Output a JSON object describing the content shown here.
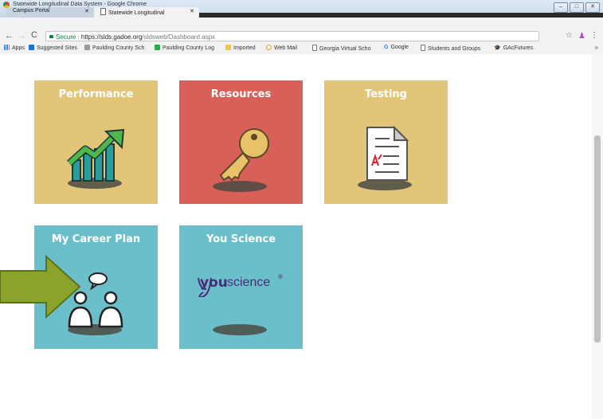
{
  "browser": {
    "app_title": "Statewide Longitudinal Data System - Google Chrome",
    "tabs": [
      {
        "label": "Campus Portal",
        "active": false
      },
      {
        "label": "Statewide Longitudinal ",
        "active": true
      }
    ],
    "secure_label": "Secure",
    "url_host": "https://slds.gadoe.org",
    "url_path": "/sldsweb/Dashboard.aspx",
    "bookmarks": [
      "Apps",
      "Suggested Sites",
      "Paulding County Sch",
      "Paulding County Log",
      "Imported",
      "Web Mail",
      "Georgia Virtual Scho",
      "Google",
      "Students and Groups",
      "GAcFutures"
    ],
    "more_bookmarks": "»"
  },
  "tiles": [
    {
      "title": "Performance",
      "color": "#e3c57a",
      "icon": "growth-chart-icon"
    },
    {
      "title": "Resources",
      "color": "#d95f59",
      "icon": "key-icon"
    },
    {
      "title": "Testing",
      "color": "#e3c57a",
      "icon": "document-icon"
    },
    {
      "title": "My Career Plan",
      "color": "#6abfca",
      "icon": "people-chat-icon"
    },
    {
      "title": "You Science",
      "color": "#6abfca",
      "icon": "youscience-logo"
    }
  ],
  "youscience_logo": {
    "you": "you",
    "science": "science",
    "reg": "®"
  },
  "pointer_arrow": {
    "color": "#8aa32a",
    "icon": "right-arrow-icon"
  }
}
